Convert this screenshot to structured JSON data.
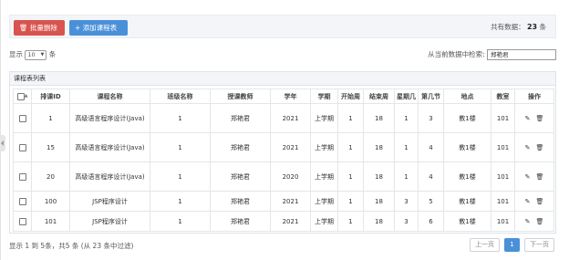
{
  "toolbar": {
    "delete_label": "批量删除",
    "delete_icon": "trash-icon",
    "add_label": "添加课程表",
    "add_icon": "plus-icon",
    "total_label": "共有数据：",
    "total_value": "23",
    "total_unit": "条"
  },
  "length": {
    "prefix": "显示",
    "value": "10",
    "suffix": "条"
  },
  "search": {
    "label": "从当前数据中检索:",
    "value": "郑艳君"
  },
  "panel": {
    "title": "课程表列表"
  },
  "table": {
    "headers": [
      "排课ID",
      "课程名称",
      "班级名称",
      "授课教师",
      "学年",
      "学期",
      "开始周",
      "结束周",
      "星期几",
      "第几节",
      "地点",
      "教室",
      "操作"
    ],
    "rows": [
      {
        "id": "1",
        "course": "高级语言程序设计(Java)",
        "class": "1",
        "teacher": "郑艳君",
        "year": "2021",
        "term": "上学期",
        "start": "1",
        "end": "18",
        "weekday": "1",
        "section": "3",
        "place": "教1楼",
        "room": "101"
      },
      {
        "id": "15",
        "course": "高级语言程序设计(Java)",
        "class": "1",
        "teacher": "郑艳君",
        "year": "2021",
        "term": "上学期",
        "start": "1",
        "end": "18",
        "weekday": "1",
        "section": "4",
        "place": "教1楼",
        "room": "101"
      },
      {
        "id": "20",
        "course": "高级语言程序设计(Java)",
        "class": "1",
        "teacher": "郑艳君",
        "year": "2020",
        "term": "上学期",
        "start": "1",
        "end": "18",
        "weekday": "1",
        "section": "4",
        "place": "教1楼",
        "room": "101"
      },
      {
        "id": "100",
        "course": "JSP程序设计",
        "class": "1",
        "teacher": "郑艳君",
        "year": "2021",
        "term": "上学期",
        "start": "1",
        "end": "18",
        "weekday": "3",
        "section": "5",
        "place": "教1楼",
        "room": "101"
      },
      {
        "id": "101",
        "course": "JSP程序设计",
        "class": "1",
        "teacher": "郑艳君",
        "year": "2021",
        "term": "上学期",
        "start": "1",
        "end": "18",
        "weekday": "3",
        "section": "6",
        "place": "教1楼",
        "room": "101"
      }
    ]
  },
  "footer": {
    "info": "显示 1 到 5条，共5 条 (从 23 条中过滤)"
  },
  "pagination": {
    "prev": "上一页",
    "current": "1",
    "next": "下一页"
  },
  "colors": {
    "danger": "#d9534f",
    "primary": "#4a90d9"
  }
}
